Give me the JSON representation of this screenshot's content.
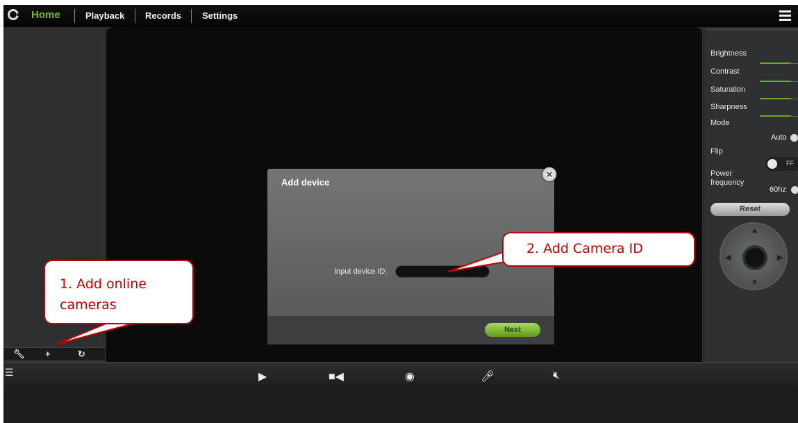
{
  "nav": {
    "items": [
      "Home",
      "Playback",
      "Records",
      "Settings"
    ]
  },
  "right_panel": {
    "brightness": {
      "label": "Brightness",
      "level": 0.55
    },
    "contrast": {
      "label": "Contrast",
      "level": 0.55
    },
    "saturation": {
      "label": "Saturation",
      "level": 0.55
    },
    "sharpness": {
      "label": "Sharpness",
      "level": 0.55
    },
    "mode": {
      "label": "Mode",
      "value": "Auto"
    },
    "flip": {
      "label": "Flip",
      "toggle_text": "FF"
    },
    "power": {
      "label": "Power frequency",
      "value": "60hz"
    },
    "reset_label": "Reset"
  },
  "dialog": {
    "title": "Add device",
    "input_label": "Input device ID:",
    "input_value": "",
    "next_label": "Next"
  },
  "callouts": {
    "add_online": "1. Add online cameras",
    "add_camera_id": "2. Add Camera ID"
  },
  "colors": {
    "accent_green": "#7ab828",
    "callout_red": "#c00000"
  },
  "icons": {
    "left_toolbar": [
      "wrench-icon",
      "plus-icon",
      "refresh-icon"
    ],
    "bottom_bar": [
      "play-icon",
      "video-record-icon",
      "camera-snapshot-icon",
      "mic-mute-icon",
      "speaker-mute-icon"
    ]
  }
}
